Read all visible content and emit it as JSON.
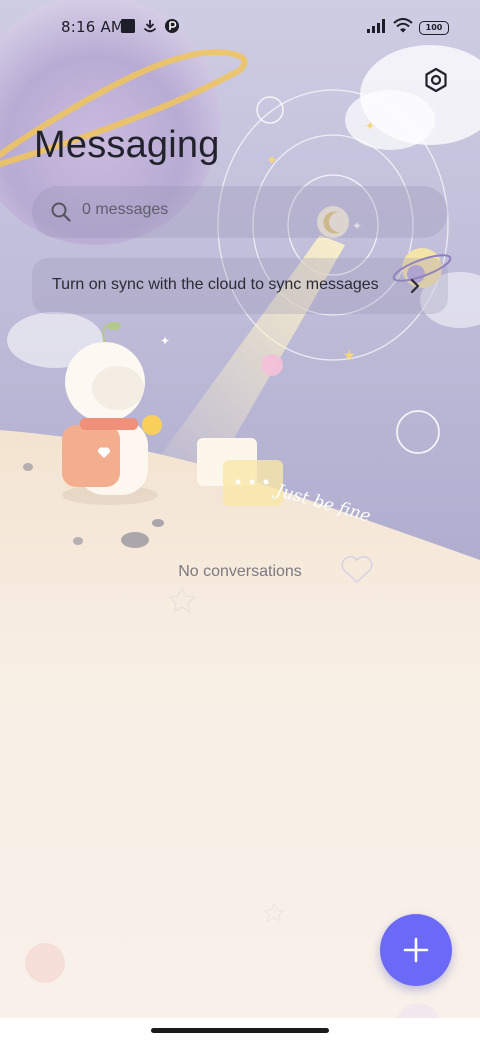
{
  "status_bar": {
    "time": "8:16 AM",
    "battery": "100",
    "left_icons": [
      "square-icon",
      "download-arrow-icon",
      "app-notification-icon"
    ],
    "right_icons": [
      "signal-icon",
      "wifi-icon",
      "battery-icon"
    ]
  },
  "header": {
    "title": "Messaging",
    "settings_icon": "settings-icon"
  },
  "search": {
    "placeholder": "0 messages",
    "icon": "search-icon"
  },
  "sync_banner": {
    "text": "Turn on sync with the cloud to sync messages",
    "icon": "chevron-right-icon"
  },
  "wallpaper": {
    "caption": "Just be fine"
  },
  "conversations": {
    "empty_text": "No conversations",
    "items": []
  },
  "fab": {
    "icon": "plus-icon",
    "color": "#6a6af7"
  },
  "colors": {
    "sky": "#b9b6d6",
    "ground": "#f9f2ea",
    "accent": "#6a6af7"
  }
}
